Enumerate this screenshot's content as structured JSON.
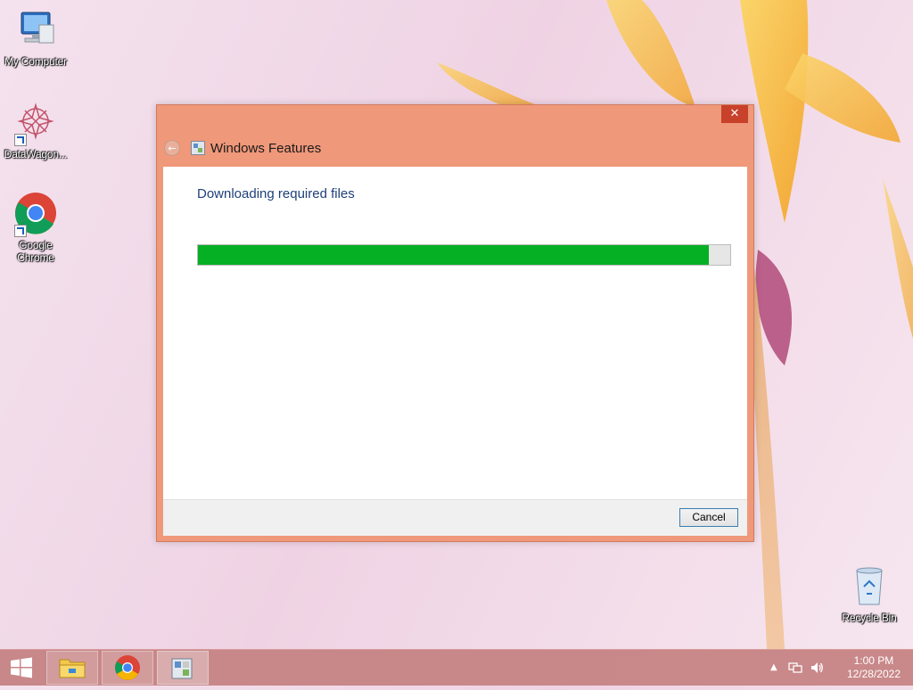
{
  "desktop": {
    "icons": [
      {
        "label": "My Computer",
        "icon": "computer-icon"
      },
      {
        "label": "DataWagon...",
        "icon": "datawagon-icon"
      },
      {
        "label": "Google Chrome",
        "icon": "chrome-icon"
      },
      {
        "label": "Recycle Bin",
        "icon": "recycle-bin-icon"
      }
    ]
  },
  "dialog": {
    "title": "Windows Features",
    "close_label": "✕",
    "back_icon": "back-arrow-icon",
    "heading": "Downloading required files",
    "progress": 0.96,
    "progress_color": "#06b025",
    "cancel_label": "Cancel"
  },
  "taskbar": {
    "start_icon": "windows-start-icon",
    "apps": [
      {
        "icon": "file-explorer-icon"
      },
      {
        "icon": "chrome-icon"
      },
      {
        "icon": "windows-features-icon",
        "active": true
      }
    ],
    "tray": {
      "overflow_icon": "tray-overflow-icon",
      "network_icon": "network-icon",
      "volume_icon": "volume-icon",
      "time": "1:00 PM",
      "date": "12/28/2022"
    }
  },
  "colors": {
    "titlebar": "#f0987a",
    "taskbar": "#c48080",
    "close": "#c7412b"
  }
}
